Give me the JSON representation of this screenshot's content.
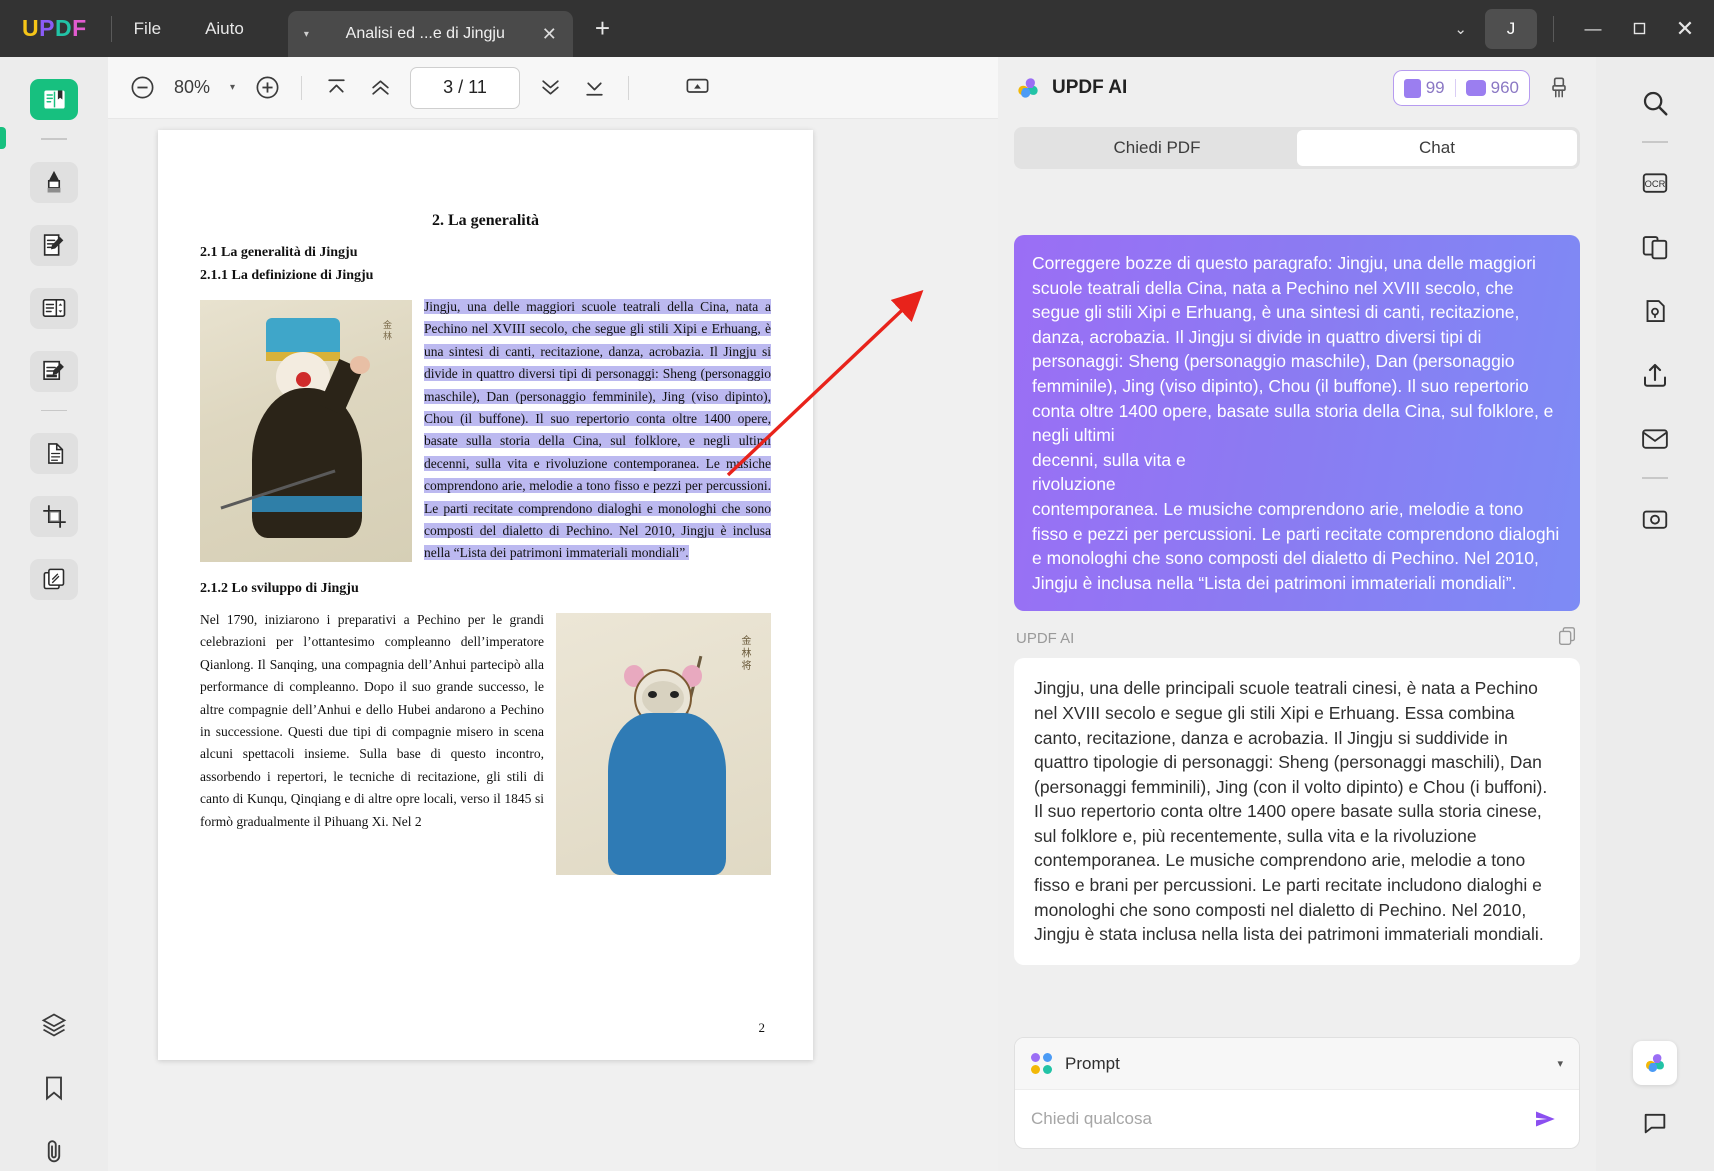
{
  "app": {
    "logo_letters": [
      "U",
      "P",
      "D",
      "F"
    ],
    "menus": [
      "File",
      "Aiuto"
    ],
    "tab_title": "Analisi ed ...e di Jingju",
    "tab_close": "✕",
    "tab_caret": "▾",
    "new_tab": "+",
    "avatar_initial": "J",
    "window_chevron": "⌄",
    "minimize": "—",
    "maximize": "☐",
    "close": "✕"
  },
  "left_rail": {
    "items": [
      {
        "name": "read-mode-icon",
        "label": "Lettore"
      },
      {
        "name": "highlighter-icon",
        "label": "Evidenziatore"
      },
      {
        "name": "edit-pdf-icon",
        "label": "Modifica PDF"
      },
      {
        "name": "organize-pages-icon",
        "label": "Organizza pagine"
      },
      {
        "name": "annotate-icon",
        "label": "Commenta"
      },
      {
        "name": "convert-icon",
        "label": "Converti"
      },
      {
        "name": "crop-icon",
        "label": "Ritaglia"
      },
      {
        "name": "batch-icon",
        "label": "Batch"
      },
      {
        "name": "layers-icon",
        "label": "Livelli"
      },
      {
        "name": "bookmark-icon",
        "label": "Segnalibro"
      },
      {
        "name": "attachment-icon",
        "label": "Allegati"
      }
    ]
  },
  "doc_toolbar": {
    "zoom_out": "−",
    "zoom_value": "80%",
    "zoom_caret": "▾",
    "zoom_in": "+",
    "first_page": "first-page-icon",
    "prev_page": "prev-page-icon",
    "page_indicator": "3 / 11",
    "current_page": "3",
    "total_pages": "11",
    "next_page": "next-page-icon",
    "last_page": "last-page-icon",
    "present": "present-icon"
  },
  "document": {
    "title": "2. La generalità",
    "h2": "2.1 La generalità di Jingju",
    "h3": "2.1.1 La definizione di Jingju",
    "highlighted_paragraph": "Jingju, una delle maggiori scuole teatrali della Cina, nata a Pechino nel XVIII secolo, che segue gli stili Xipi e Erhuang, è una sintesi di canti, recitazione, danza, acrobazia. Il Jingju si divide in quattro diversi tipi di personaggi: Sheng (personaggio maschile), Dan (personaggio femminile), Jing (viso dipinto), Chou (il buffone). Il suo repertorio conta oltre 1400 opere, basate sulla storia della Cina, sul folklore, e negli ultimi decenni, sulla vita e rivoluzione contemporanea. Le musiche comprendono arie, melodie a tono fisso e pezzi per percussioni. Le parti recitate comprendono dialoghi e monologhi che sono composti del dialetto di Pechino. Nel 2010, Jingju è inclusa nella “Lista dei patrimoni immateriali mondiali”.",
    "h3b": "2.1.2 Lo sviluppo di Jingju",
    "paragraph2": "Nel 1790, iniziarono i preparativi a Pechino per le grandi celebrazioni per l’ottantesimo compleanno dell’imperatore Qianlong. Il Sanqing, una compagnia dell’Anhui partecipò alla performance di compleanno. Dopo il suo grande successo, le altre compagnie dell’Anhui e dello Hubei andarono a Pechino in successione. Questi due tipi di compagnie misero in scena alcuni spettacoli insieme. Sulla base di questo incontro, assorbendo i repertori, le tecniche di recitazione, gli stili di canto di Kunqu, Qinqiang e di altre opre locali, verso il 1845 si formò gradualmente il Pihuang Xi. Nel 2",
    "page_number": "2",
    "figure1_caption": "金 林",
    "figure2_caption": "金 林 将"
  },
  "ai_panel": {
    "title": "UPDF AI",
    "badge_docs": "99",
    "badge_chats": "960",
    "brush_icon": "brush-icon",
    "tabs": [
      {
        "label": "Chiedi PDF",
        "active": false
      },
      {
        "label": "Chat",
        "active": true
      }
    ],
    "user_message": "Correggere bozze di questo paragrafo: Jingju, una delle maggiori scuole teatrali della Cina, nata a Pechino nel XVIII secolo, che segue gli stili Xipi e Erhuang, è una sintesi di canti, recitazione, danza, acrobazia. Il Jingju si divide in quattro diversi tipi di personaggi: Sheng (personaggio maschile), Dan (personaggio femminile), Jing (viso dipinto), Chou (il buffone). Il suo repertorio conta oltre 1400 opere, basate sulla storia della Cina, sul folklore, e negli ultimi\ndecenni, sulla vita e\nrivoluzione\ncontemporanea. Le musiche comprendono arie, melodie a tono fisso e pezzi per percussioni. Le parti recitate comprendono dialoghi e monologhi che sono composti del dialetto di Pechino. Nel 2010, Jingju è inclusa nella “Lista dei patrimoni immateriali mondiali”.",
    "response_label": "UPDF AI",
    "copy_icon": "copy-icon",
    "ai_response": "Jingju, una delle principali scuole teatrali cinesi, è nata a Pechino nel XVIII secolo e segue gli stili Xipi e Erhuang. Essa combina canto, recitazione, danza e acrobazia. Il Jingju si suddivide in quattro tipologie di personaggi: Sheng (personaggi maschili), Dan (personaggi femminili), Jing (con il volto dipinto) e Chou (i buffoni). Il suo repertorio conta oltre 1400 opere basate sulla storia cinese, sul folklore e, più recentemente, sulla vita e la rivoluzione contemporanea. Le musiche comprendono arie, melodie a tono fisso e brani per percussioni. Le parti recitate includono dialoghi e monologhi che sono composti nel dialetto di Pechino. Nel 2010, Jingju è stata inclusa nella lista dei patrimoni immateriali mondiali.",
    "prompt_label": "Prompt",
    "prompt_caret": "▾",
    "input_placeholder": "Chiedi qualcosa",
    "input_value": ""
  },
  "right_rail": {
    "items": [
      {
        "name": "search-icon",
        "label": "Cerca"
      },
      {
        "name": "ocr-icon",
        "label": "OCR"
      },
      {
        "name": "compare-icon",
        "label": "Confronta"
      },
      {
        "name": "protect-icon",
        "label": "Proteggi"
      },
      {
        "name": "share-icon",
        "label": "Condividi"
      },
      {
        "name": "email-icon",
        "label": "Email"
      },
      {
        "name": "capture-icon",
        "label": "Cattura"
      }
    ],
    "ai_button": "updf-ai-icon",
    "comment_button": "comment-icon"
  },
  "colors": {
    "accent_green": "#17c07f",
    "ai_purple": "#8b6ef3",
    "highlight": "#bcb9f0",
    "arrow_red": "#e8231b"
  }
}
